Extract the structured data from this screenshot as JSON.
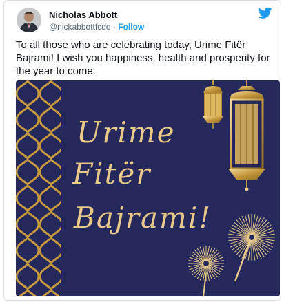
{
  "tweet": {
    "author_name": "Nicholas Abbott",
    "handle": "@nickabbottfcdo",
    "separator": "·",
    "follow_label": "Follow",
    "text": "To all those who are celebrating today, Urime Fitër Bajrami! I wish you happiness, health and prosperity for the year to come."
  },
  "image": {
    "greeting_lines": [
      "Urime",
      "Fitër",
      "Bajrami!"
    ],
    "colors": {
      "background": "#24285a",
      "gold": "#e8c98a",
      "lattice": "#c79a3f"
    }
  },
  "icons": {
    "brand": "twitter-bird-icon",
    "avatar": "author-avatar"
  }
}
